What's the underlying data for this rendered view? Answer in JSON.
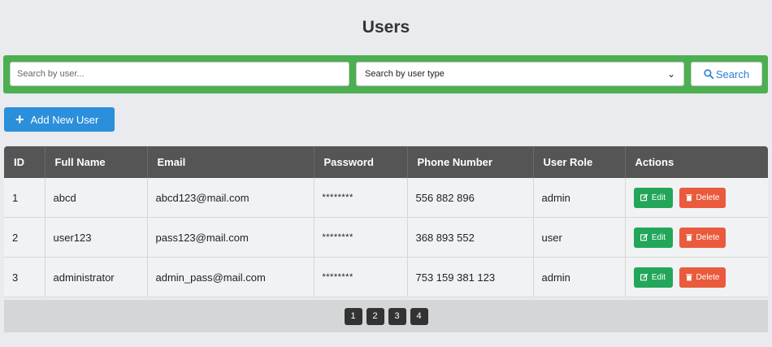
{
  "page": {
    "title": "Users"
  },
  "search": {
    "placeholder": "Search by user...",
    "type_selected": "Search by user type",
    "button_label": "Search"
  },
  "add_button_label": "Add New User",
  "table": {
    "headers": [
      "ID",
      "Full Name",
      "Email",
      "Password",
      "Phone Number",
      "User Role",
      "Actions"
    ],
    "rows": [
      {
        "id": "1",
        "name": "abcd",
        "email": "abcd123@mail.com",
        "password": "********",
        "phone": "556 882 896",
        "role": "admin"
      },
      {
        "id": "2",
        "name": "user123",
        "email": "pass123@mail.com",
        "password": "********",
        "phone": "368 893 552",
        "role": "user"
      },
      {
        "id": "3",
        "name": "administrator",
        "email": "admin_pass@mail.com",
        "password": "********",
        "phone": "753 159 381 123",
        "role": "admin"
      }
    ],
    "edit_label": "Edit",
    "delete_label": "Delete"
  },
  "pagination": {
    "pages": [
      "1",
      "2",
      "3",
      "4"
    ]
  },
  "colors": {
    "search_bar": "#4caf50",
    "add_button": "#2b8fdb",
    "header_bg": "#555555",
    "edit": "#22a65a",
    "delete": "#ea5a3d",
    "search_text": "#2a7fd4"
  },
  "icons": {
    "search": "search-icon",
    "plus": "plus-icon",
    "edit": "edit-icon",
    "delete": "trash-icon"
  }
}
